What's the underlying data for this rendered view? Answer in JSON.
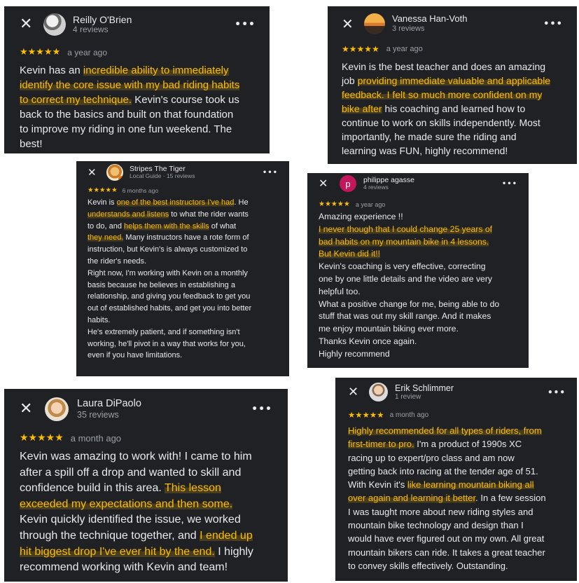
{
  "reviews": [
    {
      "id": "c1",
      "name": "Reilly O'Brien",
      "sub": "4 reviews",
      "stars": "★★★★★",
      "ago": "a year ago",
      "lines": [
        [
          [
            "Kevin has an ",
            false
          ],
          [
            "incredible ability to immediately",
            true
          ]
        ],
        [
          [
            "identify the core issue with my bad riding habits",
            true
          ]
        ],
        [
          [
            "to correct my technique.",
            true
          ],
          [
            " Kevin's course took us",
            false
          ]
        ],
        [
          [
            "back to the basics and built on that foundation",
            false
          ]
        ],
        [
          [
            "to improve my riding in one fun weekend. The",
            false
          ]
        ],
        [
          [
            "best!",
            false
          ]
        ]
      ]
    },
    {
      "id": "c2",
      "name": "Vanessa Han-Voth",
      "sub": "3 reviews",
      "stars": "★★★★★",
      "ago": "a year ago",
      "lines": [
        [
          [
            "Kevin is the best teacher and does an amazing",
            false
          ]
        ],
        [
          [
            "job ",
            false
          ],
          [
            "providing immediate valuable and applicable",
            true
          ]
        ],
        [
          [
            "feedback. I felt so much more confident on my",
            true
          ]
        ],
        [
          [
            "bike after",
            true
          ],
          [
            " his coaching and learned how to",
            false
          ]
        ],
        [
          [
            "continue to work on skills independently. Most",
            false
          ]
        ],
        [
          [
            "importantly, he made sure the riding and",
            false
          ]
        ],
        [
          [
            "learning was FUN, highly recommend!",
            false
          ]
        ]
      ]
    },
    {
      "id": "c3",
      "name": "Stripes The Tiger",
      "sub": "Local Guide · 15 reviews",
      "stars": "★★★★★",
      "ago": "6 months ago",
      "lines": [
        [
          [
            "Kevin is ",
            false
          ],
          [
            "one of the best instructors I've had",
            true
          ],
          [
            ". He",
            false
          ]
        ],
        [
          [
            "understands and listens",
            true
          ],
          [
            " to what the rider wants",
            false
          ]
        ],
        [
          [
            "to do, and ",
            false
          ],
          [
            "helps them with the skills",
            true
          ],
          [
            " of what",
            false
          ]
        ],
        [
          [
            "they need.",
            true
          ],
          [
            " Many instructors have a rote form of",
            false
          ]
        ],
        [
          [
            "instruction, but Kevin's is always customized to",
            false
          ]
        ],
        [
          [
            "the rider's needs.",
            false
          ]
        ],
        [
          [
            "Right now, I'm working with Kevin on a monthly",
            false
          ]
        ],
        [
          [
            "basis because he believes in establishing a",
            false
          ]
        ],
        [
          [
            "relationship, and giving you feedback to get you",
            false
          ]
        ],
        [
          [
            "out of established habits, and get you into better",
            false
          ]
        ],
        [
          [
            "habits.",
            false
          ]
        ],
        [
          [
            "He's extremely patient, and if something isn't",
            false
          ]
        ],
        [
          [
            "working, he'll pivot in a way that works for you,",
            false
          ]
        ],
        [
          [
            "even if you have limitations.",
            false
          ]
        ]
      ]
    },
    {
      "id": "c4",
      "name": "philippe agasse",
      "sub": "4 reviews",
      "avatar_letter": "p",
      "stars": "★★★★★",
      "ago": "a year ago",
      "lines": [
        [
          [
            "Amazing experience !!",
            false
          ]
        ],
        [
          [
            "I never though that I could change 25 years of",
            true
          ]
        ],
        [
          [
            "bad habits on my mountain bike in 4 lessons.",
            true
          ]
        ],
        [
          [
            "But Kevin did it!!",
            true
          ]
        ],
        [
          [
            "Kevin's coaching is very effective, correcting",
            false
          ]
        ],
        [
          [
            "one by one little details and the video are very",
            false
          ]
        ],
        [
          [
            "helpful too.",
            false
          ]
        ],
        [
          [
            "What a positive change for me, being able to do",
            false
          ]
        ],
        [
          [
            "stuff that was out my skill range. And it makes",
            false
          ]
        ],
        [
          [
            "me enjoy mountain biking ever more.",
            false
          ]
        ],
        [
          [
            "Thanks Kevin once again.",
            false
          ]
        ],
        [
          [
            "Highly recommend",
            false
          ]
        ]
      ]
    },
    {
      "id": "c5",
      "name": "Laura DiPaolo",
      "sub": "35 reviews",
      "stars": "★★★★★",
      "ago": "a month ago",
      "lines": [
        [
          [
            "Kevin was amazing to work with! I came to him",
            false
          ]
        ],
        [
          [
            "after a spill off a drop and wanted to skill and",
            false
          ]
        ],
        [
          [
            "confidence build in this area. ",
            false
          ],
          [
            "This lesson",
            true
          ]
        ],
        [
          [
            "exceeded my expectations and then some.",
            true
          ]
        ],
        [
          [
            "Kevin quickly identified the issue, we worked",
            false
          ]
        ],
        [
          [
            "through the technique together, and ",
            false
          ],
          [
            "I ended up",
            true
          ]
        ],
        [
          [
            "hit biggest drop I've ever hit by the end.",
            true
          ],
          [
            " I highly",
            false
          ]
        ],
        [
          [
            "recommend working with Kevin and team!",
            false
          ]
        ]
      ]
    },
    {
      "id": "c6",
      "name": "Erik Schlimmer",
      "sub": "1 review",
      "stars": "★★★★★",
      "ago": "a month ago",
      "lines": [
        [
          [
            "Highly recommended for all types of riders, from",
            true
          ]
        ],
        [
          [
            "first-timer to pro.",
            true
          ],
          [
            " I'm a product of 1990s XC",
            false
          ]
        ],
        [
          [
            "racing up to expert/pro class and am now",
            false
          ]
        ],
        [
          [
            "getting back into racing at the tender age of 51.",
            false
          ]
        ],
        [
          [
            "With Kevin it's ",
            false
          ],
          [
            "like learning mountain biking all",
            true
          ]
        ],
        [
          [
            "over again and learning it better",
            true
          ],
          [
            ". In a few session",
            false
          ]
        ],
        [
          [
            "I was taught more about new riding styles and",
            false
          ]
        ],
        [
          [
            "mountain bike technology and design than I",
            false
          ]
        ],
        [
          [
            "would have ever figured out on my own. All great",
            false
          ]
        ],
        [
          [
            "mountain bikers can ride. It takes a great teacher",
            false
          ]
        ],
        [
          [
            "to convey skills effectively. Outstanding.",
            false
          ]
        ]
      ]
    }
  ],
  "icons": {
    "close": "✕",
    "more": "•••"
  },
  "colors": {
    "card_bg": "#202124",
    "text": "#e8eaed",
    "muted": "#9aa0a6",
    "star": "#fbbc04",
    "highlight": "#fbbc04"
  }
}
